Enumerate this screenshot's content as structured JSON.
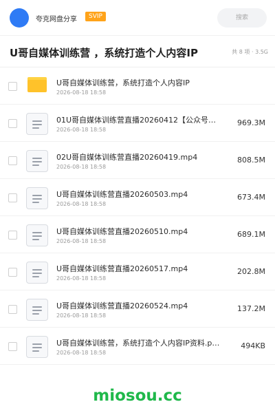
{
  "top": {
    "share_name": "夸克网盘分享",
    "badge": "SVIP",
    "search_placeholder": "搜索"
  },
  "header": {
    "title": "U哥自媒体训练营 ，系统打造个人内容IP",
    "meta": "共 8 项 · 3.5G"
  },
  "files": [
    {
      "type": "folder",
      "name": "U哥自媒体训练营，系统打造个人内容IP",
      "date": "2026-08-18 18:58",
      "size": ""
    },
    {
      "type": "file",
      "name": "01U哥自媒体训练营直播20260412【公众号：…",
      "date": "2026-08-18 18:58",
      "size": "969.3M"
    },
    {
      "type": "file",
      "name": "02U哥自媒体训练营直播20260419.mp4",
      "date": "2026-08-18 18:58",
      "size": "808.5M"
    },
    {
      "type": "file",
      "name": "U哥自媒体训练营直播20260503.mp4",
      "date": "2026-08-18 18:58",
      "size": "673.4M"
    },
    {
      "type": "file",
      "name": "U哥自媒体训练营直播20260510.mp4",
      "date": "2026-08-18 18:58",
      "size": "689.1M"
    },
    {
      "type": "file",
      "name": "U哥自媒体训练营直播20260517.mp4",
      "date": "2026-08-18 18:58",
      "size": "202.8M"
    },
    {
      "type": "file",
      "name": "U哥自媒体训练营直播20260524.mp4",
      "date": "2026-08-18 18:58",
      "size": "137.2M"
    },
    {
      "type": "file",
      "name": "U哥自媒体训练营，系统打造个人内容IP资料.png",
      "date": "2026-08-18 18:58",
      "size": "494KB"
    }
  ],
  "watermark": "miosou.cc",
  "colors": {
    "accent": "#2f7bf5",
    "svip": "#ffa31a",
    "folder": "#ffc22a",
    "watermark": "#1fb84a"
  }
}
